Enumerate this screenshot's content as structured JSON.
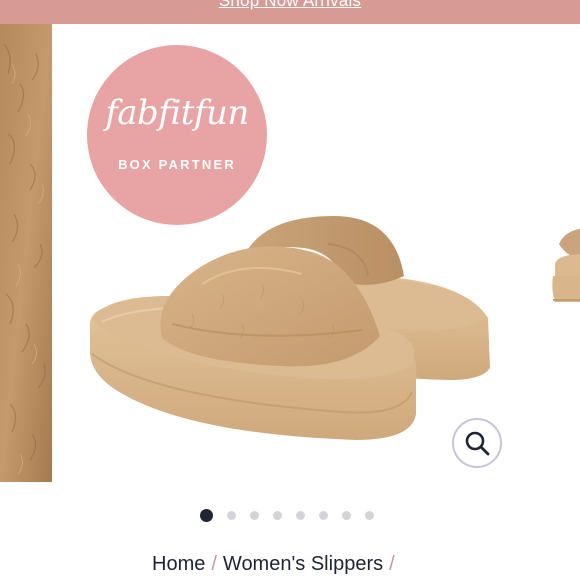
{
  "promo": {
    "link_text": "Shop Now Arrivals"
  },
  "badge": {
    "logo_text": "fabfitfun",
    "subtitle": "BOX PARTNER"
  },
  "carousel": {
    "slide_count": 8,
    "active_index": 0
  },
  "icons": {
    "zoom": "magnifier-icon"
  },
  "breadcrumb": {
    "items": [
      "Home",
      "Women's Slippers"
    ],
    "separator": "/"
  },
  "colors": {
    "banner": "#d89a95",
    "badge": "#e8a3a4",
    "dot_active": "#1f2433",
    "dot_inactive": "#d4d4d8",
    "text": "#1f2433",
    "separator": "#c49a9a"
  }
}
